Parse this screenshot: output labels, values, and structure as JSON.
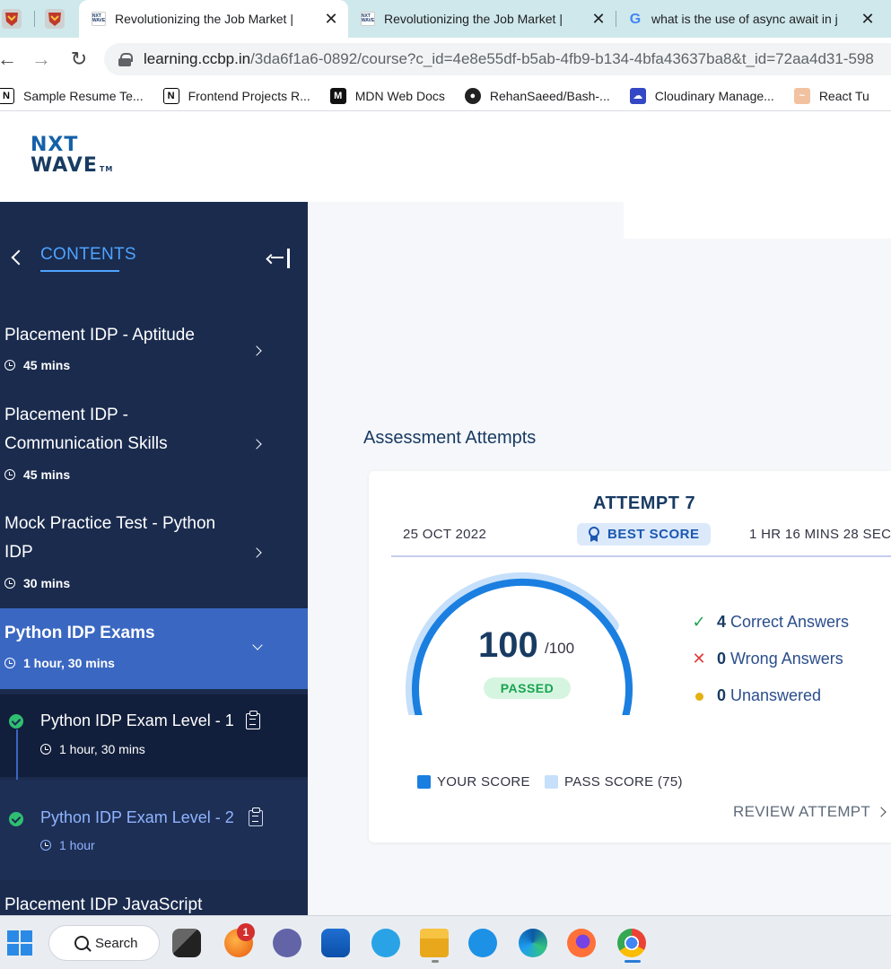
{
  "browser": {
    "tabs": [
      {
        "title": "Revolutionizing the Job Market |",
        "active": true
      },
      {
        "title": "Revolutionizing the Job Market |",
        "active": false
      },
      {
        "title": "what is the use of async await in j",
        "active": false
      }
    ],
    "url_host": "learning.ccbp.in",
    "url_path": "/3da6f1a6-0892/course?c_id=4e8e55df-b5ab-4fb9-b134-4bfa43637ba8&t_id=72aa4d31-598",
    "bookmarks": [
      {
        "label": "Sample Resume Te...",
        "icon": "notion-icon"
      },
      {
        "label": "Frontend Projects R...",
        "icon": "notion-icon"
      },
      {
        "label": "MDN Web Docs",
        "icon": "mdn-icon"
      },
      {
        "label": "RehanSaeed/Bash-...",
        "icon": "github-icon"
      },
      {
        "label": "Cloudinary Manage...",
        "icon": "cloudinary-icon"
      },
      {
        "label": "React Tu",
        "icon": "react-icon"
      }
    ]
  },
  "site": {
    "logo_line1": "NXT",
    "logo_line2": "WAVE",
    "logo_tm": "TM"
  },
  "sidebar": {
    "heading": "CONTENTS",
    "items": [
      {
        "title": "Placement IDP - Aptitude",
        "duration": "45 mins"
      },
      {
        "title": "Placement IDP - Communication Skills",
        "duration": "45 mins"
      },
      {
        "title": "Mock Practice Test - Python IDP",
        "duration": "30 mins"
      },
      {
        "title": "Python IDP Exams",
        "duration": "1 hour, 30 mins"
      },
      {
        "title": "Placement IDP JavaScript"
      }
    ],
    "sub_items": [
      {
        "title": "Python IDP Exam Level - 1",
        "duration": "1 hour, 30 mins",
        "completed": true
      },
      {
        "title": "Python IDP Exam Level - 2",
        "duration": "1 hour",
        "completed": true
      }
    ]
  },
  "main": {
    "section_title": "Assessment Attempts",
    "attempt": {
      "title": "ATTEMPT 7",
      "date": "25 OCT 2022",
      "badge": "BEST SCORE",
      "time_taken": "1 HR 16 MINS 28 SEC",
      "score": "100",
      "score_max": "/100",
      "status": "PASSED",
      "score_value": 100,
      "pass_value": 75,
      "stats": [
        {
          "count": "4",
          "label": "Correct Answers",
          "icon": "check-icon"
        },
        {
          "count": "0",
          "label": "Wrong Answers",
          "icon": "cross-icon"
        },
        {
          "count": "0",
          "label": "Unanswered",
          "icon": "dot-icon"
        }
      ],
      "legend": [
        {
          "label": "YOUR SCORE",
          "color": "#1a7fe0"
        },
        {
          "label": "PASS SCORE (75)",
          "color": "#c6e0fb"
        }
      ],
      "review_label": "REVIEW ATTEMPT"
    }
  },
  "taskbar": {
    "search_label": "Search",
    "notification_count": "1"
  }
}
